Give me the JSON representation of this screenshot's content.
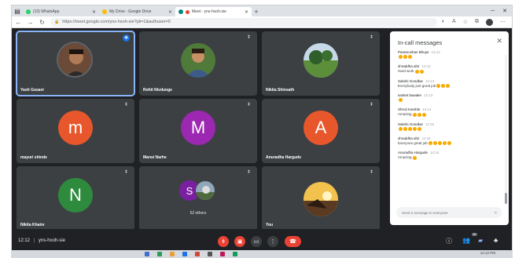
{
  "browser": {
    "tabs": [
      {
        "label": "(10) WhatsApp",
        "fav_color": "#25d366",
        "active": false
      },
      {
        "label": "My Drive - Google Drive",
        "fav_color": "#fbbc04",
        "active": false
      },
      {
        "label": "Meet - yns-hxoh-sie",
        "fav_color": "#00897b",
        "active": true
      }
    ],
    "new_tab": "+",
    "url": "https://meet.google.com/yns-hxoh-sie?pli=1&authuser=0"
  },
  "participants": [
    {
      "name": "Yash Gosavi",
      "speaking": true
    },
    {
      "name": "Rohit Nivdunge"
    },
    {
      "name": "Nikita Shinsath"
    },
    {
      "name": "mayuri shinde",
      "initial": "m",
      "color": "#e8572c"
    },
    {
      "name": "Mansi Narhe",
      "initial": "M",
      "color": "#9c27b0"
    },
    {
      "name": "Anuradha Hargude",
      "initial": "A",
      "color": "#e8572c"
    },
    {
      "name": "Nikita Khaire",
      "initial": "N",
      "color": "#2e8b3e"
    },
    {
      "name": "",
      "others_initial": "S",
      "others_label": "52 others"
    },
    {
      "name": "You"
    }
  ],
  "chat": {
    "title": "In-call messages",
    "input_placeholder": "Send a message to everyone",
    "messages": [
      {
        "sender": "Paramoshan Bhuye",
        "time": "12:12",
        "text": "",
        "emoji": 3
      },
      {
        "sender": "shraddha ahir",
        "time": "12:12",
        "text": "Hard work",
        "emoji": 2
      },
      {
        "sender": "Sakshi Gondkar",
        "time": "12:13",
        "text": "Everybody just great job",
        "emoji": 3
      },
      {
        "sender": "sanket bawake",
        "time": "12:13",
        "text": "",
        "emoji": 1
      },
      {
        "sender": "Shruti Kamble",
        "time": "12:14",
        "text": "Amazing",
        "emoji": 3
      },
      {
        "sender": "Sakshi Gondkar",
        "time": "12:15",
        "text": "",
        "emoji": 5
      },
      {
        "sender": "shraddha ahir",
        "time": "12:15",
        "text": "Everyone great job",
        "emoji": 5
      },
      {
        "sender": "Anuradha Hargude",
        "time": "12:16",
        "text": "Amazing",
        "emoji": 1
      }
    ]
  },
  "bottombar": {
    "time": "12:12",
    "separator": "|",
    "meeting_code": "yns-hxoh-sie",
    "people_count": "60"
  },
  "taskbar": {
    "clock": "12:12 PM"
  }
}
